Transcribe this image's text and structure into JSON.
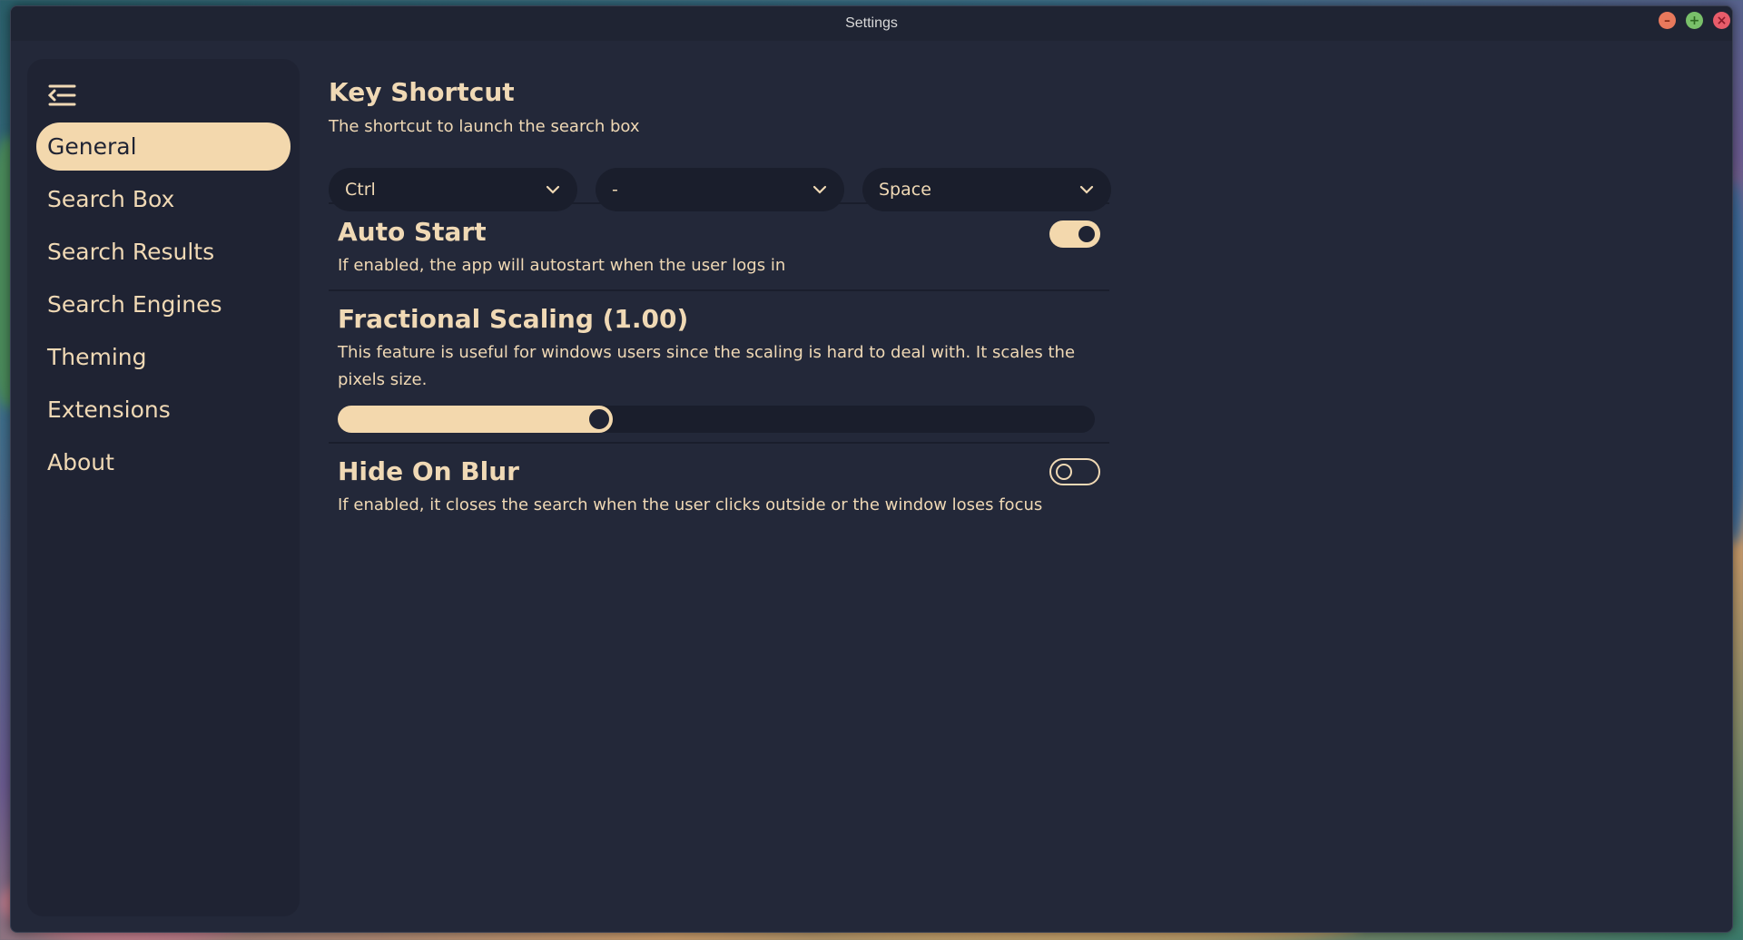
{
  "window": {
    "title": "Settings",
    "controls": [
      "–",
      "+",
      "×"
    ]
  },
  "sidebar": {
    "menu_icon": "menu-collapse-icon",
    "items": [
      {
        "label": "General",
        "active": true
      },
      {
        "label": "Search Box",
        "active": false
      },
      {
        "label": "Search Results",
        "active": false
      },
      {
        "label": "Search Engines",
        "active": false
      },
      {
        "label": "Theming",
        "active": false
      },
      {
        "label": "Extensions",
        "active": false
      },
      {
        "label": "About",
        "active": false
      }
    ]
  },
  "key_shortcut": {
    "title": "Key Shortcut",
    "description": "The shortcut to launch the search box",
    "modifier1": "Ctrl",
    "modifier2": "-",
    "key": "Space"
  },
  "auto_start": {
    "title": "Auto Start",
    "description": "If enabled, the app will autostart when the user logs in",
    "enabled": true
  },
  "fractional_scaling": {
    "title": "Fractional Scaling (1.00)",
    "description": "This feature is useful for windows users since the scaling is hard to deal with. It scales the pixels size.",
    "value_fraction": 0.345
  },
  "hide_on_blur": {
    "title": "Hide On Blur",
    "description": "If enabled, it closes the search when the user clicks outside or the window loses focus",
    "enabled": false
  },
  "colors": {
    "background": "#232839",
    "sidebar": "#1f2333",
    "accent": "#f3d8ad",
    "text": "#f0d9b5"
  }
}
